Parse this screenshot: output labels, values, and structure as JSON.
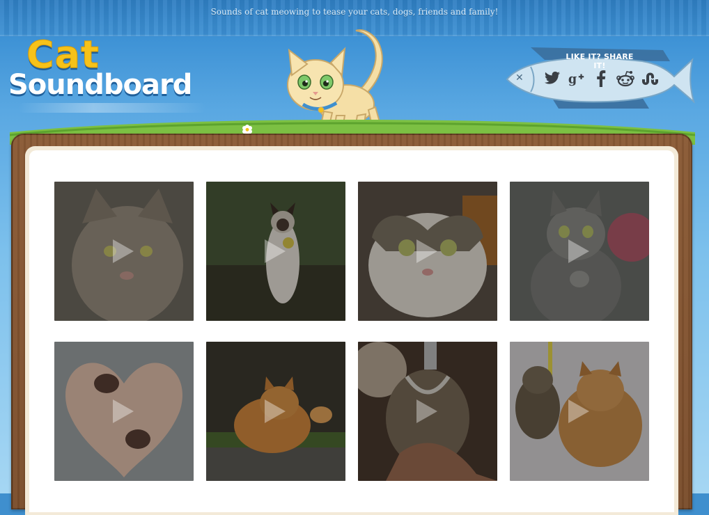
{
  "header": {
    "tagline": "Sounds of cat meowing to tease your cats, dogs, friends and family!",
    "logo": {
      "line1": "Cat",
      "line2": "Soundboard"
    }
  },
  "share": {
    "title": "LIKE IT? SHARE IT!",
    "buttons": [
      {
        "name": "twitter",
        "icon": "twitter-bird-icon"
      },
      {
        "name": "google-plus",
        "icon": "google-plus-icon"
      },
      {
        "name": "facebook",
        "icon": "facebook-f-icon"
      },
      {
        "name": "reddit",
        "icon": "reddit-alien-icon"
      },
      {
        "name": "stumbleupon",
        "icon": "stumbleupon-icon"
      }
    ]
  },
  "colors": {
    "logo_yellow": "#f6c21a",
    "board_brown": "#7a4d2b",
    "grass_green": "#7cc043",
    "sky_blue": "#3f93d6"
  },
  "tiles": [
    {
      "icon": "play-icon"
    },
    {
      "icon": "play-icon"
    },
    {
      "icon": "play-icon"
    },
    {
      "icon": "play-icon"
    },
    {
      "icon": "play-icon"
    },
    {
      "icon": "play-icon"
    },
    {
      "icon": "play-icon"
    },
    {
      "icon": "play-icon"
    }
  ]
}
